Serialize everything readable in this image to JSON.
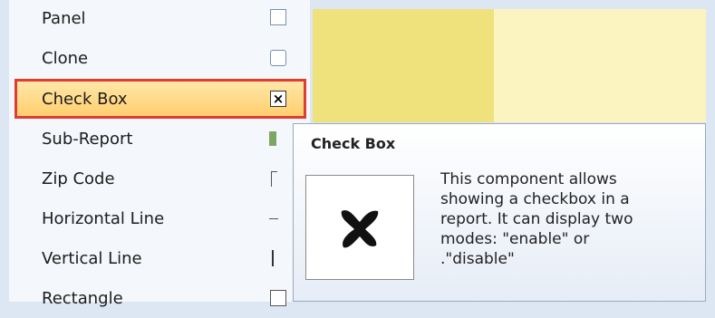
{
  "menu": {
    "items": [
      {
        "label": "Panel",
        "icon": "panel-icon"
      },
      {
        "label": "Clone",
        "icon": "clone-icon"
      },
      {
        "label": "Check Box",
        "icon": "checkbox-icon",
        "selected": true
      },
      {
        "label": "Sub-Report",
        "icon": "subreport-icon"
      },
      {
        "label": "Zip Code",
        "icon": "zipcode-icon"
      },
      {
        "label": "Horizontal Line",
        "icon": "horizontal-line-icon"
      },
      {
        "label": "Vertical Line",
        "icon": "vertical-line-icon"
      },
      {
        "label": "Rectangle",
        "icon": "rectangle-icon"
      }
    ],
    "checkbox_glyph": "×"
  },
  "tooltip": {
    "title": "Check Box",
    "image_icon": "checkmark-icon",
    "description": "This component allows\nshowing a checkbox in a\nreport. It can display two\nmodes: \"enable\" or\n.\"disable\""
  },
  "colors": {
    "highlight_border": "#e03c31",
    "highlight_fill": "#ffcf6e",
    "panel_yellow": "#efe27c"
  }
}
